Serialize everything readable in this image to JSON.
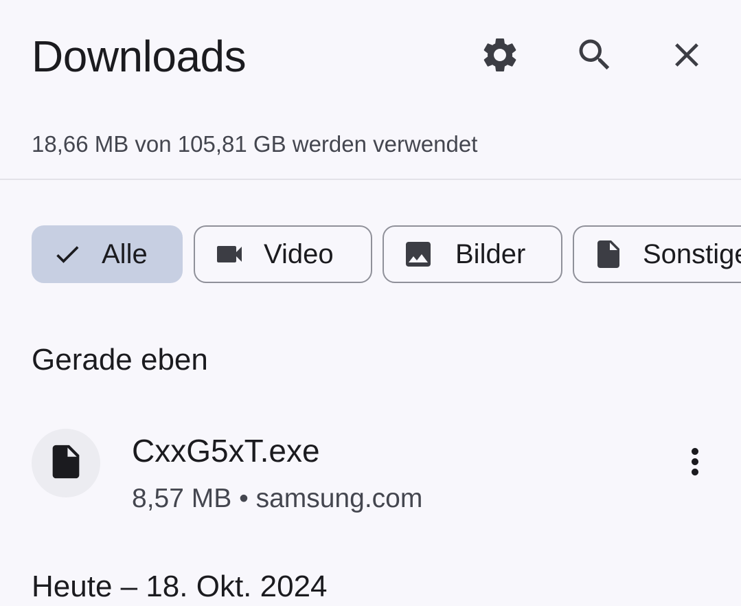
{
  "header": {
    "title": "Downloads",
    "icons": {
      "settings": "gear-icon",
      "search": "search-icon",
      "close": "close-icon"
    }
  },
  "storage": {
    "text": "18,66 MB von 105,81 GB werden verwendet"
  },
  "filters": [
    {
      "label": "Alle",
      "icon": "check-icon",
      "selected": true
    },
    {
      "label": "Video",
      "icon": "video-icon",
      "selected": false
    },
    {
      "label": "Bilder",
      "icon": "image-icon",
      "selected": false
    },
    {
      "label": "Sonstige",
      "icon": "file-icon",
      "selected": false
    }
  ],
  "sections": [
    {
      "title": "Gerade eben",
      "items": [
        {
          "name": "CxxG5xT.exe",
          "meta": "8,57 MB • samsung.com",
          "icon": "file-icon"
        }
      ]
    },
    {
      "title": "Heute – 18. Okt. 2024",
      "items": []
    }
  ],
  "colors": {
    "background": "#f8f7fc",
    "chip_selected": "#c7cfe2",
    "chip_border": "#8f9099",
    "text_primary": "#1b1b1f",
    "text_secondary": "#44464f",
    "icon": "#3c3d44"
  }
}
